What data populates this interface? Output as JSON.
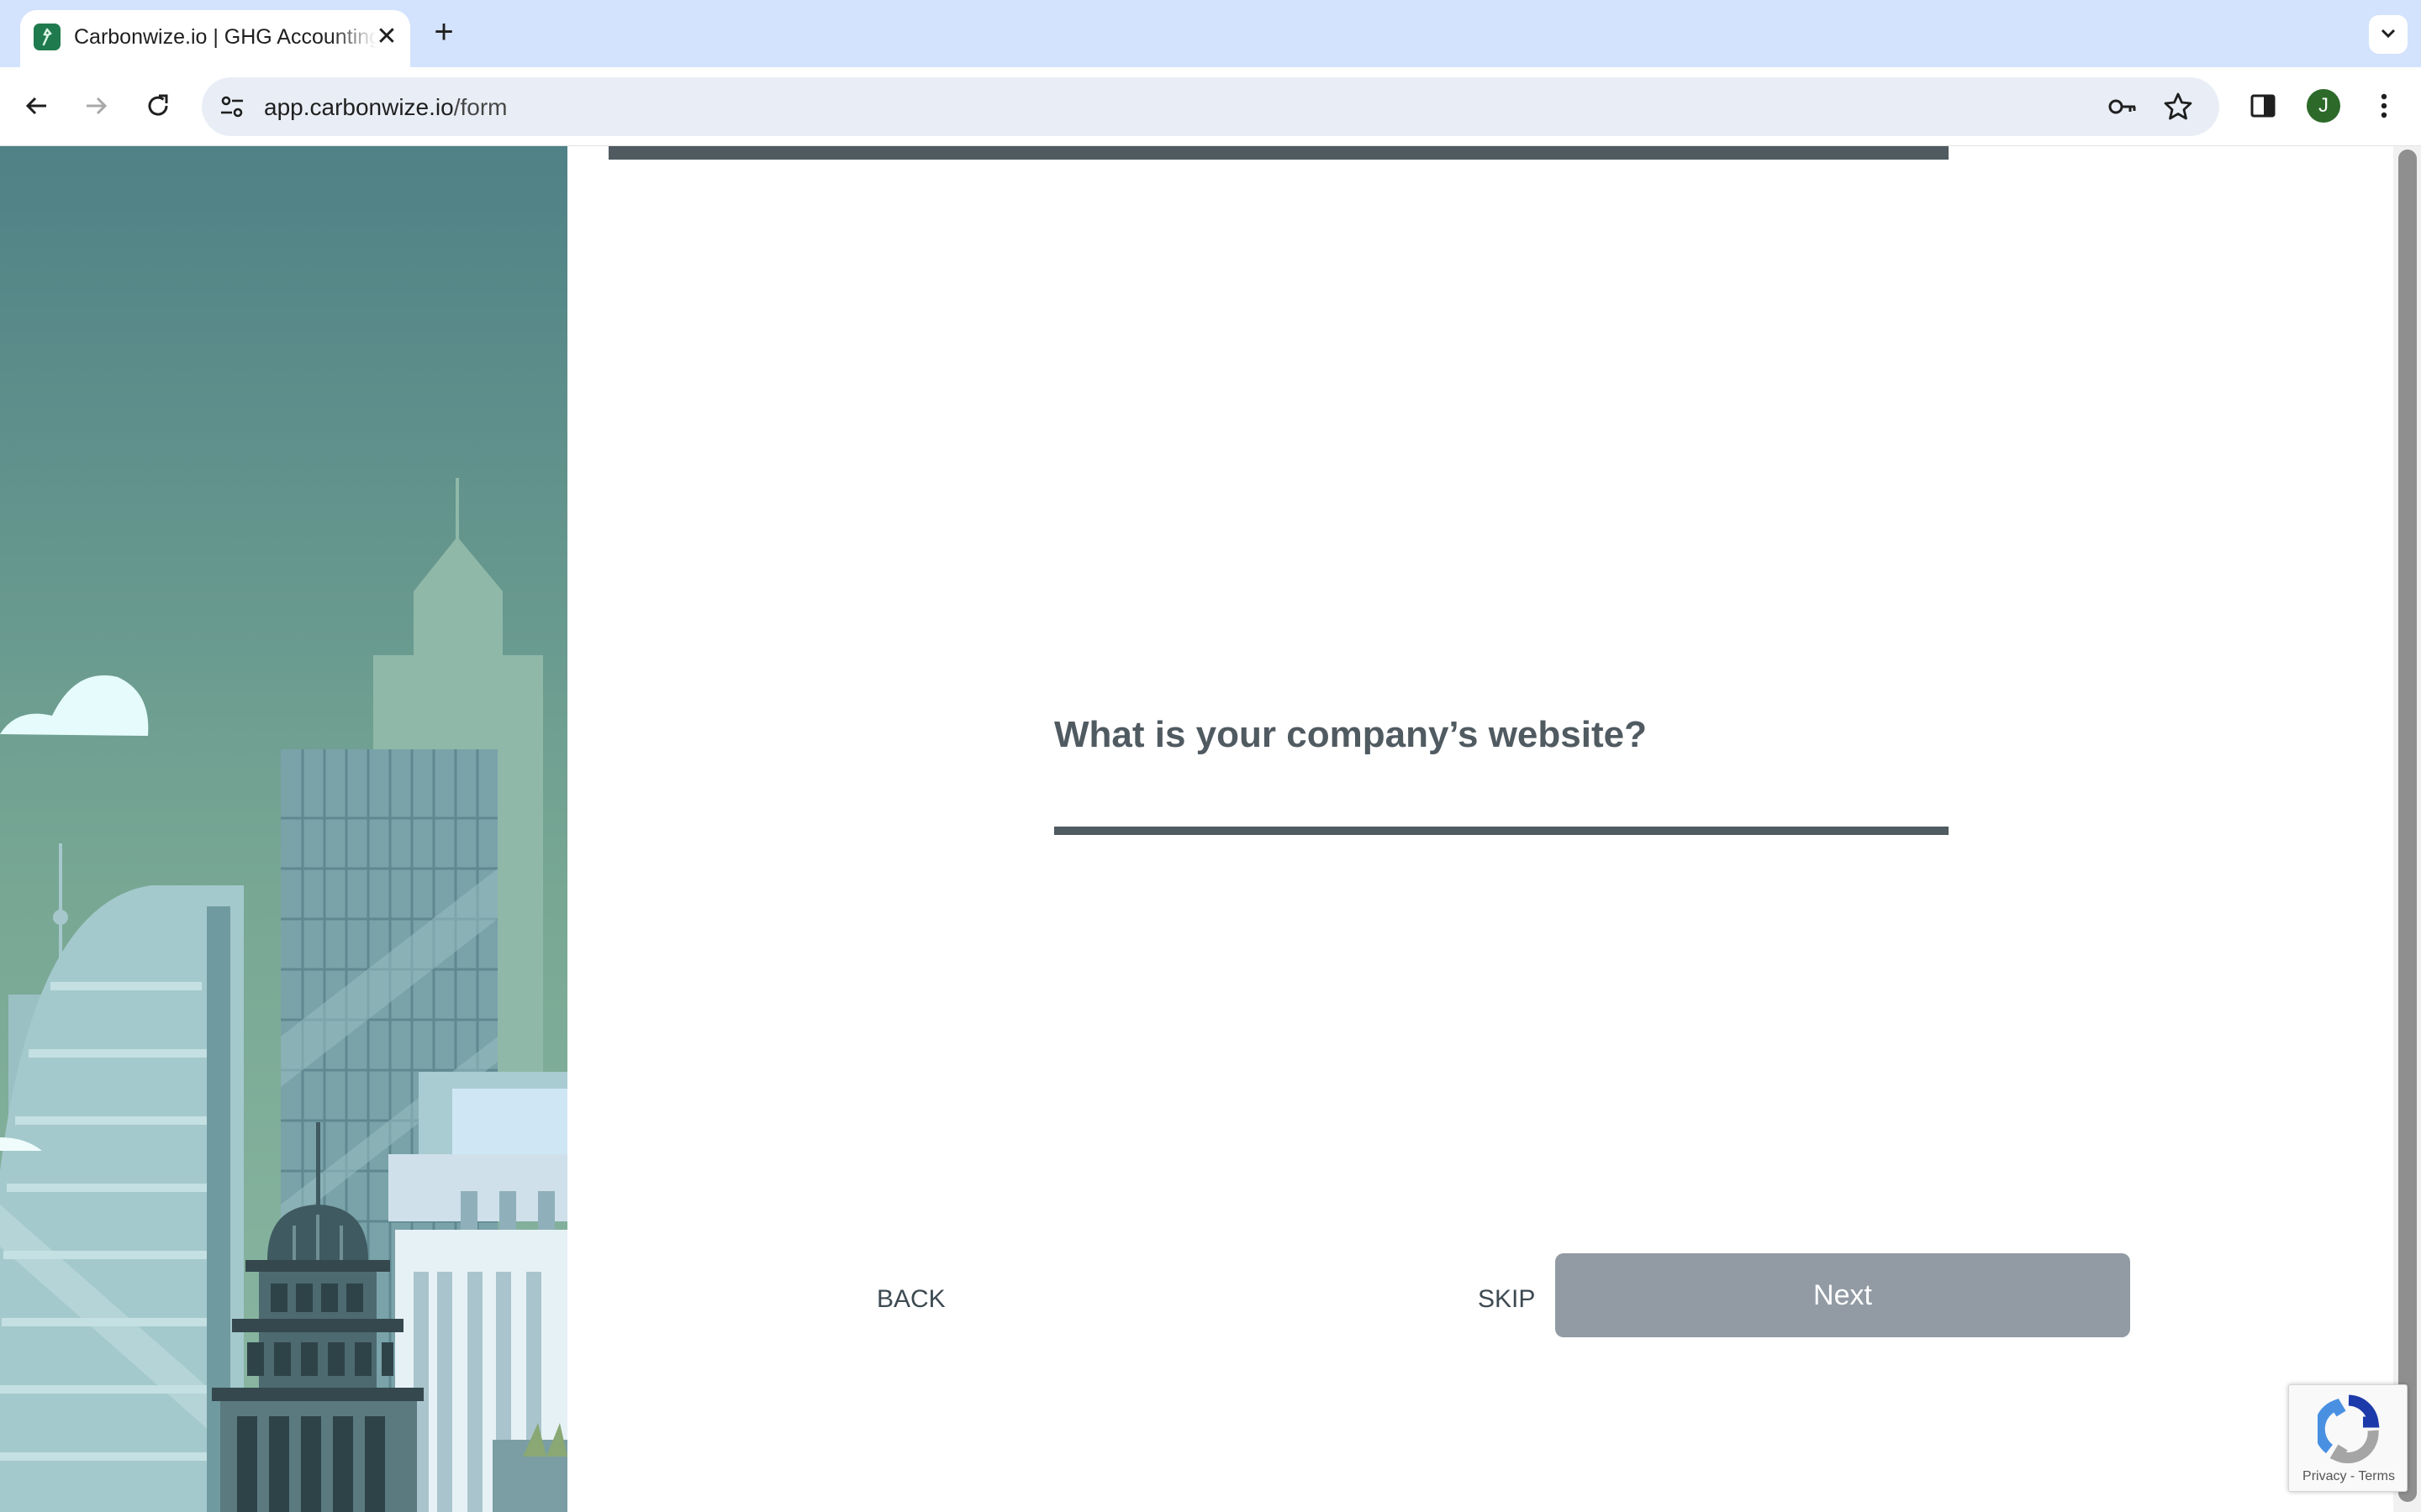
{
  "browser": {
    "tab_title": "Carbonwize.io | GHG Accounting",
    "tab_close": "✕",
    "new_tab": "+",
    "url_host": "app.carbonwize.io",
    "url_path": "/form",
    "avatar_letter": "J",
    "icons": [
      "back-icon",
      "forward-icon",
      "reload-icon",
      "site-info-icon",
      "key-icon",
      "star-icon",
      "side-panel-icon",
      "menu-icon",
      "tab-search-icon"
    ]
  },
  "form": {
    "question": "What is your company’s website?",
    "answer_value": "",
    "back_label": "BACK",
    "skip_label": "SKIP",
    "next_label": "Next"
  },
  "recaptcha": {
    "privacy": "Privacy",
    "separator": " - ",
    "terms": "Terms"
  },
  "colors": {
    "primary_text": "#505a61",
    "next_button_disabled": "#929ba3",
    "tab_strip": "#d3e3fd",
    "sky_top": "#4f8186",
    "sky_bottom": "#86b3a0"
  }
}
